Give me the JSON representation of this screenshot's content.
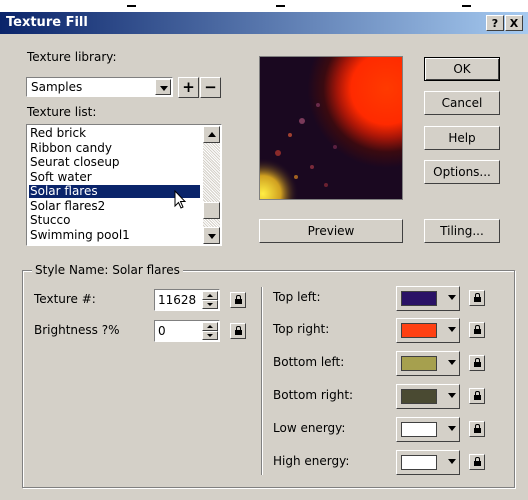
{
  "dialog": {
    "title": "Texture Fill",
    "help_btn": "?",
    "close_btn": "X"
  },
  "library": {
    "label": "Texture library:",
    "selected": "Samples",
    "add_label": "+",
    "remove_label": "−"
  },
  "texture_list": {
    "label": "Texture list:",
    "items": [
      "Red brick",
      "Ribbon candy",
      "Seurat closeup",
      "Soft water",
      "Solar flares",
      "Solar flares2",
      "Stucco",
      "Swimming pool1"
    ],
    "selected_index": 4
  },
  "buttons": {
    "ok": "OK",
    "cancel": "Cancel",
    "help": "Help",
    "options": "Options...",
    "preview": "Preview",
    "tiling": "Tiling..."
  },
  "style": {
    "group_label": "Style Name: Solar flares",
    "texture_label": "Texture #:",
    "texture_value": "11628",
    "brightness_label": "Brightness ?%",
    "brightness_value": "0"
  },
  "colors": [
    {
      "label": "Top left:",
      "hex": "#2a1266"
    },
    {
      "label": "Top right:",
      "hex": "#ff4012"
    },
    {
      "label": "Bottom left:",
      "hex": "#a6a04e"
    },
    {
      "label": "Bottom right:",
      "hex": "#4a4a32"
    },
    {
      "label": "Low energy:",
      "hex": "#ffffff"
    },
    {
      "label": "High energy:",
      "hex": "#ffffff"
    }
  ]
}
